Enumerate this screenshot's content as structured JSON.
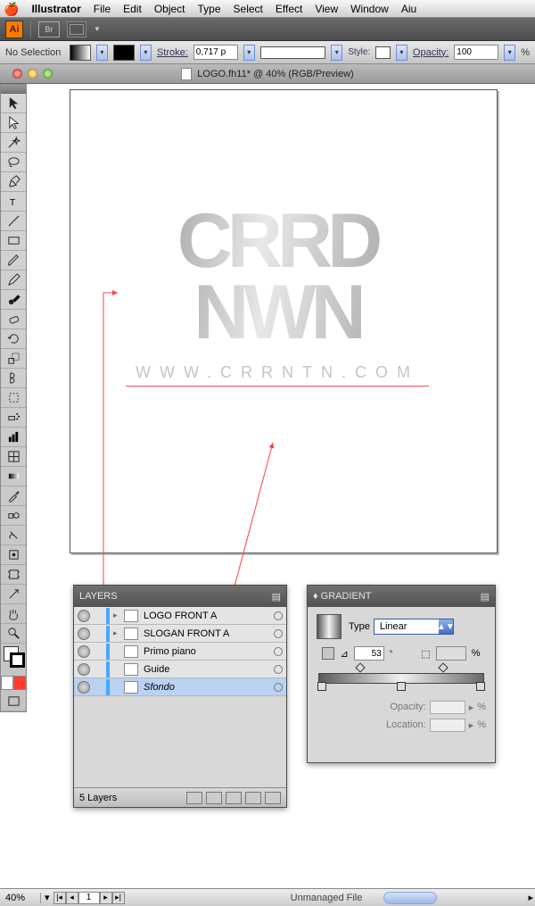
{
  "menubar": {
    "app": "Illustrator",
    "items": [
      "File",
      "Edit",
      "Object",
      "Type",
      "Select",
      "Effect",
      "View",
      "Window",
      "Aiu"
    ]
  },
  "appbar": {
    "ai": "Ai",
    "br": "Br"
  },
  "ctrlbar": {
    "selection": "No Selection",
    "stroke_label": "Stroke:",
    "stroke_val": "0,717 p",
    "style_label": "Style:",
    "opacity_label": "Opacity:",
    "opacity_val": "100",
    "pct": "%"
  },
  "doc": {
    "title": "LOGO.fh11* @ 40% (RGB/Preview)"
  },
  "artwork": {
    "row1": "CRRD",
    "row2": "NWN",
    "url": "WWW.CRRNTN.COM"
  },
  "layers": {
    "title": "LAYERS",
    "rows": [
      {
        "name": "LOGO FRONT A",
        "sel": false
      },
      {
        "name": "SLOGAN FRONT A",
        "sel": false
      },
      {
        "name": "Primo piano",
        "sel": false
      },
      {
        "name": "Guide",
        "sel": false
      },
      {
        "name": "Sfondo",
        "sel": true
      }
    ],
    "count": "5 Layers"
  },
  "gradient": {
    "title": "GRADIENT",
    "type_label": "Type",
    "type_value": "Linear",
    "angle": "53",
    "angle_pre": "⊿",
    "stops": [
      0,
      50,
      100
    ],
    "dias": [
      25,
      75
    ],
    "opacity_label": "Opacity:",
    "location_label": "Location:",
    "pct": "%"
  },
  "status": {
    "zoom": "40%",
    "page": "1",
    "msg": "Unmanaged File"
  }
}
